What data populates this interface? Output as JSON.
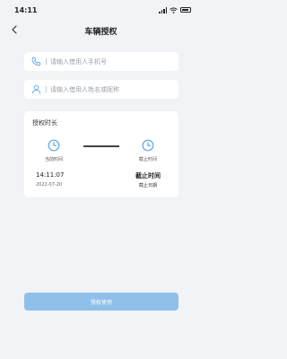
{
  "status_bar": {
    "time": "14:11"
  },
  "nav": {
    "title": "车辆授权",
    "back_icon": "chevron-left-icon"
  },
  "phone_input": {
    "icon": "phone-icon",
    "value": "",
    "placeholder": "请输入借用人手机号"
  },
  "name_input": {
    "icon": "user-icon",
    "value": "",
    "placeholder": "请输入借用人姓名或昵称"
  },
  "authorization": {
    "section_label": "授权时长",
    "start": {
      "icon": "clock-icon",
      "label": "当前时间",
      "time": "14:11:07",
      "date": "2022-07-20"
    },
    "end": {
      "icon": "clock-icon",
      "label": "截止时间",
      "time": "截止时间",
      "date": "截止日期"
    }
  },
  "submit": {
    "label": "授权使用"
  },
  "colors": {
    "accent": "#5aa6e6",
    "button": "#8fc0ea",
    "background": "#f1f3f6"
  }
}
